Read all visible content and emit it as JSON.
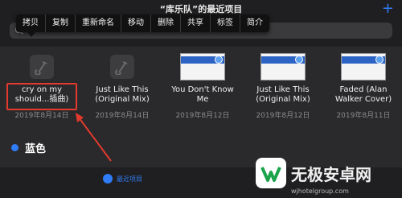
{
  "header": {
    "title": "“库乐队”的最近项目",
    "add_label": "+"
  },
  "context_menu": {
    "items": [
      "拷贝",
      "复制",
      "重新命名",
      "移动",
      "删除",
      "共享",
      "标签",
      "简介"
    ]
  },
  "files": [
    {
      "name": "cry on my should...插曲)",
      "date": "2019年8月14日",
      "kind": "garageband"
    },
    {
      "name": "Just Like This (Original Mix)",
      "date": "2019年8月14日",
      "kind": "garageband"
    },
    {
      "name": "You Don't Know Me",
      "date": "2019年8月12日",
      "kind": "document"
    },
    {
      "name": "Just Like This (Original Mix)",
      "date": "2019年8月12日",
      "kind": "document"
    },
    {
      "name": "Faded (Alan Walker Cover)",
      "date": "2019年8月11日",
      "kind": "document"
    }
  ],
  "tag": {
    "label": "蓝色",
    "color": "#2f7cf6"
  },
  "tabbar": {
    "recent_label": "最近项目"
  },
  "watermark": {
    "text": "无极安卓网",
    "url": "wjhotelgroup.com"
  },
  "colors": {
    "accent": "#2f7cf6",
    "highlight": "#e23a2e"
  }
}
